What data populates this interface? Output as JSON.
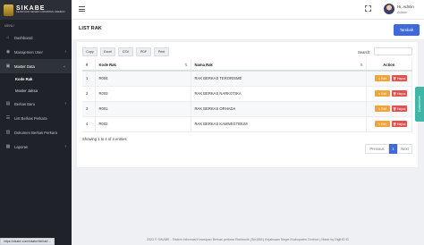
{
  "brand": {
    "title": "SIKABE",
    "subtitle": "KEJAKSAAN NEGERI KABUPATEN CIREBON"
  },
  "sidebar": {
    "menu_label": "MENU",
    "items": [
      {
        "label": "Dashboard",
        "icon": "home-icon"
      },
      {
        "label": "Manajemen User",
        "icon": "users-icon"
      },
      {
        "label": "Master Data",
        "icon": "folder-icon"
      },
      {
        "label": "Kode Rak"
      },
      {
        "label": "Master Jaksa"
      },
      {
        "label": "Berkas Baru",
        "icon": "file-icon"
      },
      {
        "label": "List Berkas Perkara",
        "icon": "list-icon"
      },
      {
        "label": "Dokumen Berkas Perkara",
        "icon": "document-icon"
      },
      {
        "label": "Laporan",
        "icon": "report-icon"
      }
    ]
  },
  "topbar": {
    "user_name": "Hi, Admin",
    "user_role": "Admin"
  },
  "page": {
    "title": "LIST RAK",
    "add_button": "Tambah"
  },
  "table": {
    "export_buttons": [
      "Copy",
      "Excel",
      "CSV",
      "PDF",
      "Print"
    ],
    "search_label": "Search:",
    "search_value": "",
    "columns": [
      "#",
      "Kode Rak",
      "Nama Rak",
      "Action"
    ],
    "rows": [
      {
        "no": "1",
        "kode": "R004",
        "nama": "RAK BERKAS TERORISME"
      },
      {
        "no": "2",
        "kode": "R003",
        "nama": "RAK BERKAS NARKOTIKA"
      },
      {
        "no": "3",
        "kode": "R001",
        "nama": "RAK BERKAS ORHADA"
      },
      {
        "no": "4",
        "kode": "R002",
        "nama": "RAK BERKAS KAMNEGTIBUM"
      }
    ],
    "edit_label": "Edit",
    "delete_label": "Hapus",
    "info": "Showing 1 to 4 of 4 entries",
    "pager": {
      "previous": "Previous",
      "page": "1",
      "next": "Next"
    }
  },
  "customizer_label": "Customizer",
  "footer": "2023 © SIKABE - Sistem Informasi Kearsipan Berkas perkara Elektronik (SIKABE) Kejaksaan Negeri Kabupaten Cirebon | Made by DigiHD ID",
  "status_url": "https://sikabe.com/sikabe/list/rak/..."
}
